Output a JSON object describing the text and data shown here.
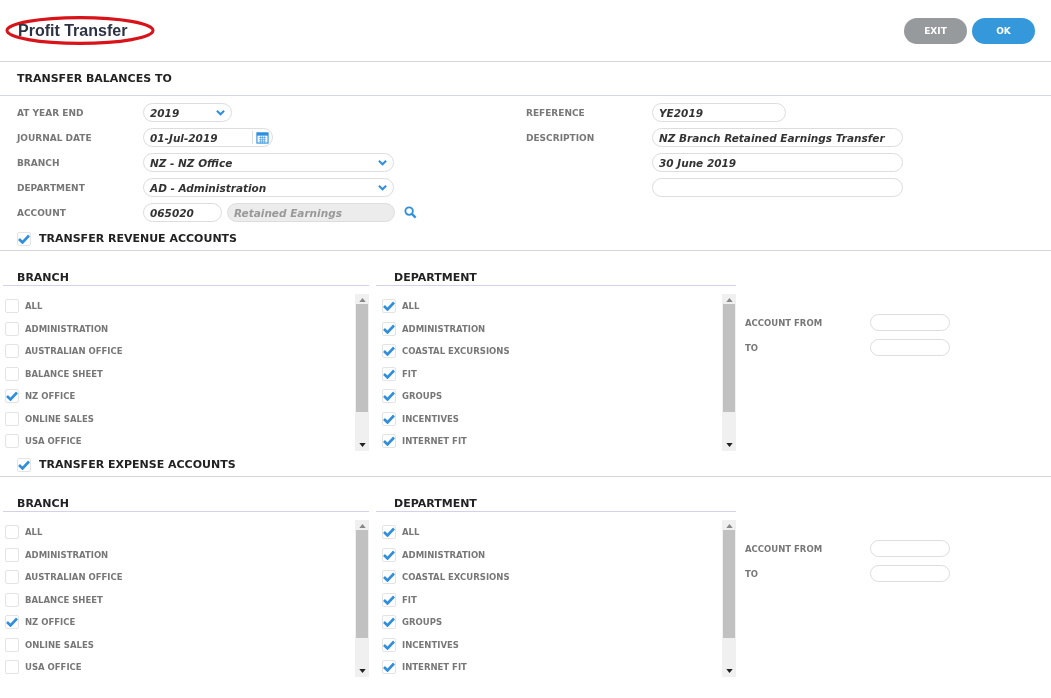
{
  "header": {
    "title": "Profit Transfer",
    "buttons": [
      {
        "label": "EXIT",
        "kind": "secondary"
      },
      {
        "label": "OK",
        "kind": "primary"
      }
    ]
  },
  "balances": {
    "heading": "TRANSFER BALANCES TO",
    "left_fields": [
      {
        "label": "AT YEAR END",
        "kind": "select",
        "value": "2019"
      },
      {
        "label": "JOURNAL DATE",
        "kind": "date",
        "value": "01-Jul-2019"
      },
      {
        "label": "BRANCH",
        "kind": "select",
        "value": "NZ - NZ Office"
      },
      {
        "label": "DEPARTMENT",
        "kind": "select",
        "value": "AD - Administration"
      },
      {
        "label": "ACCOUNT",
        "kind": "account",
        "value": "065020",
        "name": "Retained Earnings"
      }
    ],
    "right_fields": [
      {
        "kind": "text",
        "label": "REFERENCE",
        "value": "YE2019"
      },
      {
        "kind": "text",
        "label": "DESCRIPTION",
        "value": "NZ Branch Retained Earnings Transfer"
      },
      {
        "kind": "text",
        "value": "30 June 2019"
      },
      {
        "kind": "text"
      }
    ]
  },
  "sections": [
    {
      "label": "TRANSFER REVENUE ACCOUNTS",
      "checked": true,
      "branch": {
        "heading": "BRANCH",
        "items": [
          {
            "label": "ALL",
            "checked": false
          },
          {
            "label": "ADMINISTRATION",
            "checked": false
          },
          {
            "label": "AUSTRALIAN OFFICE",
            "checked": false
          },
          {
            "label": "BALANCE SHEET",
            "checked": false
          },
          {
            "label": "NZ OFFICE",
            "checked": true
          },
          {
            "label": "ONLINE SALES",
            "checked": false
          },
          {
            "label": "USA OFFICE",
            "checked": false
          }
        ]
      },
      "department": {
        "heading": "DEPARTMENT",
        "items": [
          {
            "label": "ALL",
            "checked": true
          },
          {
            "label": "ADMINISTRATION",
            "checked": true
          },
          {
            "label": "COASTAL EXCURSIONS",
            "checked": true
          },
          {
            "label": "FIT",
            "checked": true
          },
          {
            "label": "GROUPS",
            "checked": true
          },
          {
            "label": "INCENTIVES",
            "checked": true
          },
          {
            "label": "INTERNET FIT",
            "checked": true
          }
        ]
      },
      "account_from": "ACCOUNT FROM",
      "to": "TO"
    },
    {
      "label": "TRANSFER EXPENSE ACCOUNTS",
      "checked": true,
      "branch": {
        "heading": "BRANCH",
        "items": [
          {
            "label": "ALL",
            "checked": false
          },
          {
            "label": "ADMINISTRATION",
            "checked": false
          },
          {
            "label": "AUSTRALIAN OFFICE",
            "checked": false
          },
          {
            "label": "BALANCE SHEET",
            "checked": false
          },
          {
            "label": "NZ OFFICE",
            "checked": true
          },
          {
            "label": "ONLINE SALES",
            "checked": false
          },
          {
            "label": "USA OFFICE",
            "checked": false
          }
        ]
      },
      "department": {
        "heading": "DEPARTMENT",
        "items": [
          {
            "label": "ALL",
            "checked": true
          },
          {
            "label": "ADMINISTRATION",
            "checked": true
          },
          {
            "label": "COASTAL EXCURSIONS",
            "checked": true
          },
          {
            "label": "FIT",
            "checked": true
          },
          {
            "label": "GROUPS",
            "checked": true
          },
          {
            "label": "INCENTIVES",
            "checked": true
          },
          {
            "label": "INTERNET FIT",
            "checked": true
          }
        ]
      },
      "account_from": "ACCOUNT FROM",
      "to": "TO"
    }
  ]
}
